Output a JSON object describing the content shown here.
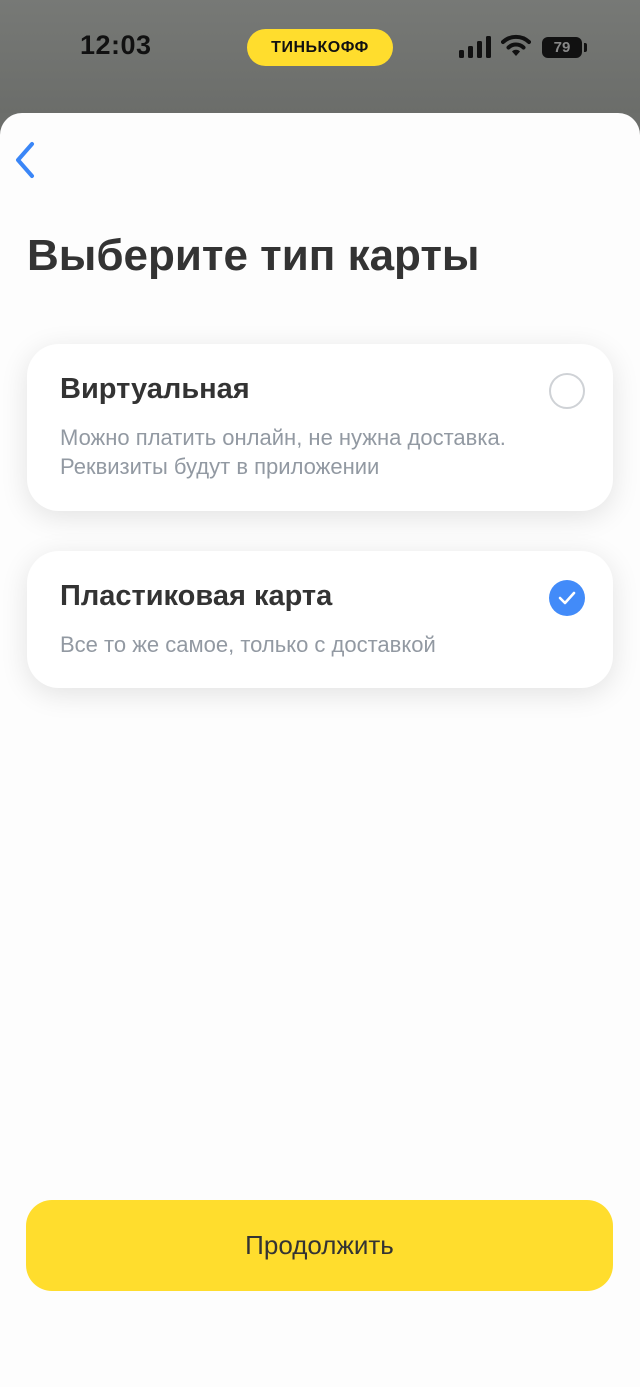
{
  "status_bar": {
    "time": "12:03",
    "brand": "ТИНЬКОФФ",
    "battery": "79",
    "brand_color": "#ffdd2d"
  },
  "header": {
    "back_icon": "chevron-left-icon",
    "title": "Выберите тип карты"
  },
  "options": [
    {
      "title": "Виртуальная",
      "description": "Можно платить онлайн, не нужна доставка. Реквизиты будут в приложении",
      "selected": false
    },
    {
      "title": "Пластиковая карта",
      "description": "Все то же самое, только с доставкой",
      "selected": true
    }
  ],
  "continue_label": "Продолжить",
  "colors": {
    "accent_blue": "#428bf9",
    "button_yellow": "#ffdd2d",
    "text_primary": "#333333",
    "text_secondary": "#9299a2"
  }
}
